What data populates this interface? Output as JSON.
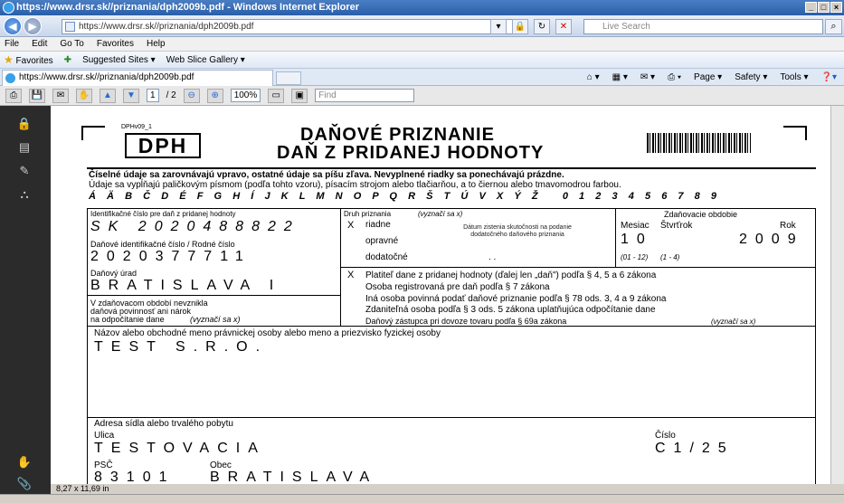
{
  "window": {
    "title": "https://www.drsr.sk//priznania/dph2009b.pdf - Windows Internet Explorer",
    "controls": [
      "_",
      "□",
      "×"
    ]
  },
  "address_bar": {
    "url": "https://www.drsr.sk//priznania/dph2009b.pdf",
    "search_placeholder": "Live Search"
  },
  "menu": [
    "File",
    "Edit",
    "Go To",
    "Favorites",
    "Help"
  ],
  "favorites_bar": {
    "label": "Favorites",
    "items": [
      "Suggested Sites ▾",
      "Web Slice Gallery ▾"
    ]
  },
  "tab": {
    "title": "https://www.drsr.sk//priznania/dph2009b.pdf",
    "tools": [
      "Page ▾",
      "Safety ▾",
      "Tools ▾"
    ]
  },
  "pdf_toolbar": {
    "page_current": "1",
    "page_total": "/ 2",
    "zoom": "100%",
    "find_placeholder": "Find"
  },
  "page_size_label": "8,27 x 11,69 in",
  "form": {
    "code": "DPHv09_1",
    "badge": "DPH",
    "title_line1": "DAŇOVÉ PRIZNANIE",
    "title_line2": "DAŇ Z PRIDANEJ HODNOTY",
    "instructions_bold": "Číselné údaje sa zarovnávajú vpravo, ostatné údaje sa píšu zľava. Nevyplnené riadky sa ponechávajú prázdne.",
    "instructions": "Údaje sa vypĺňajú paličkovým písmom (podľa tohto vzoru), písacím strojom alebo tlačiarňou, a to čiernou alebo tmavomodrou farbou.",
    "alphabet": "Á  Ä  B  Č  D  É  F  G  H  Í  J  K  L  M  N  O  P  Q  R  Š  T  Ú  V  X  Ý  Ž     0  1  2  3  4  5  6  7  8  9",
    "ic_dph_label": "Identifikačné číslo pre daň z pridanej hodnoty",
    "ic_dph_value": "SK 2020488822",
    "dic_label": "Daňové identifikačné číslo / Rodné číslo",
    "dic_value": "2020377711",
    "office_label": "Daňový úrad",
    "office_value": "BRATISLAVA I",
    "no_obligation": [
      "V zdaňovacom období nevznikla",
      "daňová povinnosť ani nárok",
      "na odpočítanie dane"
    ],
    "no_obligation_hint": "(vyznačí sa x)",
    "type_label": "Druh priznania",
    "type_hint": "(vyznačí sa x)",
    "type_x": "X",
    "type_options": [
      "riadne",
      "opravné",
      "dodatočné"
    ],
    "discovery_hint": [
      "Dátum zistenia skutočnosti na podanie",
      "dodatočného daňového priznania"
    ],
    "date_dots": ".          .",
    "period_label": "Zdaňovacie obdobie",
    "period_cols": [
      "Mesiac",
      "Štvrťrok",
      "Rok"
    ],
    "month_value": "10",
    "year_value": "2009",
    "month_range": "(01 - 12)",
    "quarter_range": "(1 - 4)",
    "payer_x": "X",
    "payer_options": [
      "Platiteľ dane z pridanej hodnoty (ďalej len „daň\") podľa § 4, 5 a 6 zákona",
      "Osoba registrovaná pre daň podľa § 7 zákona",
      "Iná osoba povinná podať daňové priznanie podľa § 78 ods. 3, 4 a 9 zákona",
      "Zdaniteľná osoba podľa § 3 ods. 5 zákona uplatňujúca odpočítanie dane",
      "Daňový zástupca pri dovoze tovaru podľa § 69a zákona"
    ],
    "payer_hint": "(vyznačí sa x)",
    "name_label": "Názov alebo obchodné meno právnickej osoby alebo meno a priezvisko fyzickej osoby",
    "name_value": "TEST S.R.O.",
    "address_label": "Adresa sídla alebo trvalého pobytu",
    "street_label": "Ulica",
    "street_value": "TESTOVACIA",
    "number_label": "Číslo",
    "number_value": "C1/25",
    "psc_label": "PSČ",
    "psc_value": "83101",
    "city_label": "Obec",
    "city_value": "BRATISLAVA"
  }
}
